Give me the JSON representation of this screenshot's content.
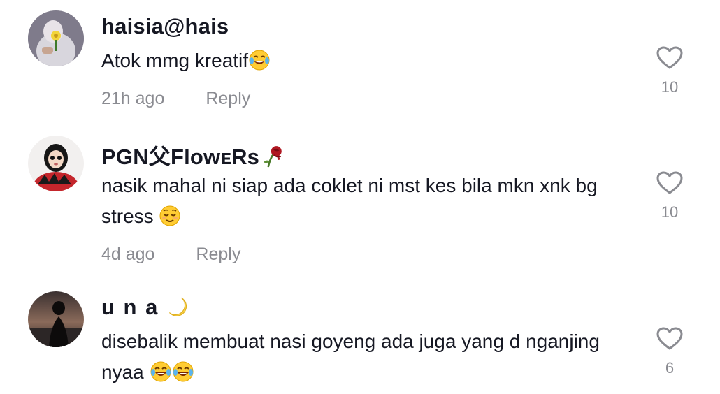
{
  "comments": [
    {
      "username": "haisia@hais",
      "text": "Atok mmg kreatif",
      "text_emoji": "face-with-tears-of-joy",
      "time": "21h ago",
      "reply_label": "Reply",
      "likes": "10",
      "avatar_icon": "user-avatar"
    },
    {
      "username": "PGN父FlowᴇRs",
      "username_emoji": "wilted-rose",
      "text": "nasik mahal ni siap ada coklet ni mst kes bila mkn xnk bg stress",
      "text_emoji": "relieved-face",
      "time": "4d ago",
      "reply_label": "Reply",
      "likes": "10",
      "avatar_icon": "user-avatar"
    },
    {
      "username": "u n a",
      "username_emoji": "crescent-moon",
      "text": "disebalik membuat nasi goyeng ada juga yang d nganjing nyaa",
      "text_emoji": "face-with-tears-of-joy",
      "likes": "6",
      "avatar_icon": "user-avatar"
    }
  ],
  "colors": {
    "primary_text": "#161823",
    "secondary_text": "#8a8b91",
    "heart_outline": "#8a8b91"
  }
}
